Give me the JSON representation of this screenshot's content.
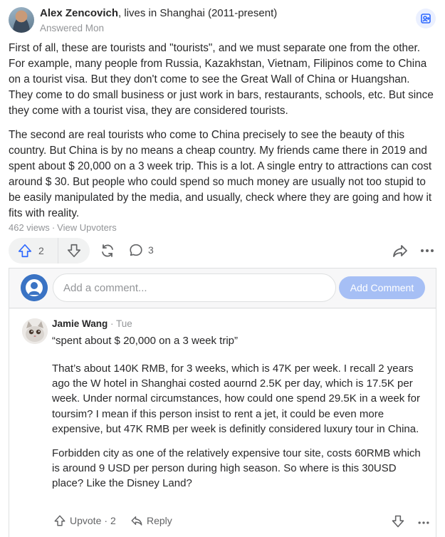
{
  "answer": {
    "author_name": "Alex Zencovich",
    "author_credential": ", lives in Shanghai (2011-present)",
    "answered": "Answered Mon",
    "paragraphs": [
      "First of all, these are tourists and \"tourists\", and we must separate one from the other. For example, many people from Russia, Kazakhstan, Vietnam, Filipinos come to China on a tourist visa. But they don't come to see the Great Wall of China or Huangshan. They come to do small business or just work in bars, restaurants, schools, etc. But since they come with a tourist visa, they are considered tourists.",
      "The second are real tourists who come to China precisely to see the beauty of this country. But China is by no means a cheap country. My friends came there in 2019 and spent about $ 20,000 on a 3 week trip. This is a lot. A single entry to attractions can cost around $ 30. But people who could spend so much money are usually not too stupid to be easily manipulated by the media, and usually, check where they are going and how it fits with reality."
    ],
    "views": "462 views",
    "view_upvoters": "View Upvoters",
    "upvote_count": "2",
    "comment_count": "3"
  },
  "comments": {
    "input_placeholder": "Add a comment...",
    "add_button": "Add Comment",
    "items": [
      {
        "author": "Jamie Wang",
        "time": "Tue",
        "quote": "“spent about $ 20,000 on a 3 week trip”",
        "paragraphs": [
          "That’s about 140K RMB, for 3 weeks, which is 47K per week. I recall 2 years ago the W hotel in Shanghai costed aournd 2.5K per day, which is 17.5K per week. Under normal circumstances, how could one spend 29.5K in a week for toursim? I mean if this person insist to rent a jet, it could be even more expensive, but 47K RMB per week is definitly considered luxury tour in China.",
          "Forbidden city as one of the relatively expensive tour site, costs 60RMB which is around 9 USD per person during high season. So where is this 30USD place? Like the Disney Land?"
        ],
        "upvote_label": "Upvote",
        "upvote_count": "2",
        "reply_label": "Reply"
      }
    ]
  },
  "colors": {
    "text": "#282829",
    "muted": "#939598",
    "accent": "#2e69ff",
    "button_disabled": "#a6bff5",
    "panel_bg": "#f7f7f8"
  },
  "icons": [
    "upvote-icon",
    "downvote-icon",
    "share-icon",
    "comment-icon",
    "forward-icon",
    "more-icon",
    "follow-icon",
    "reply-icon"
  ]
}
